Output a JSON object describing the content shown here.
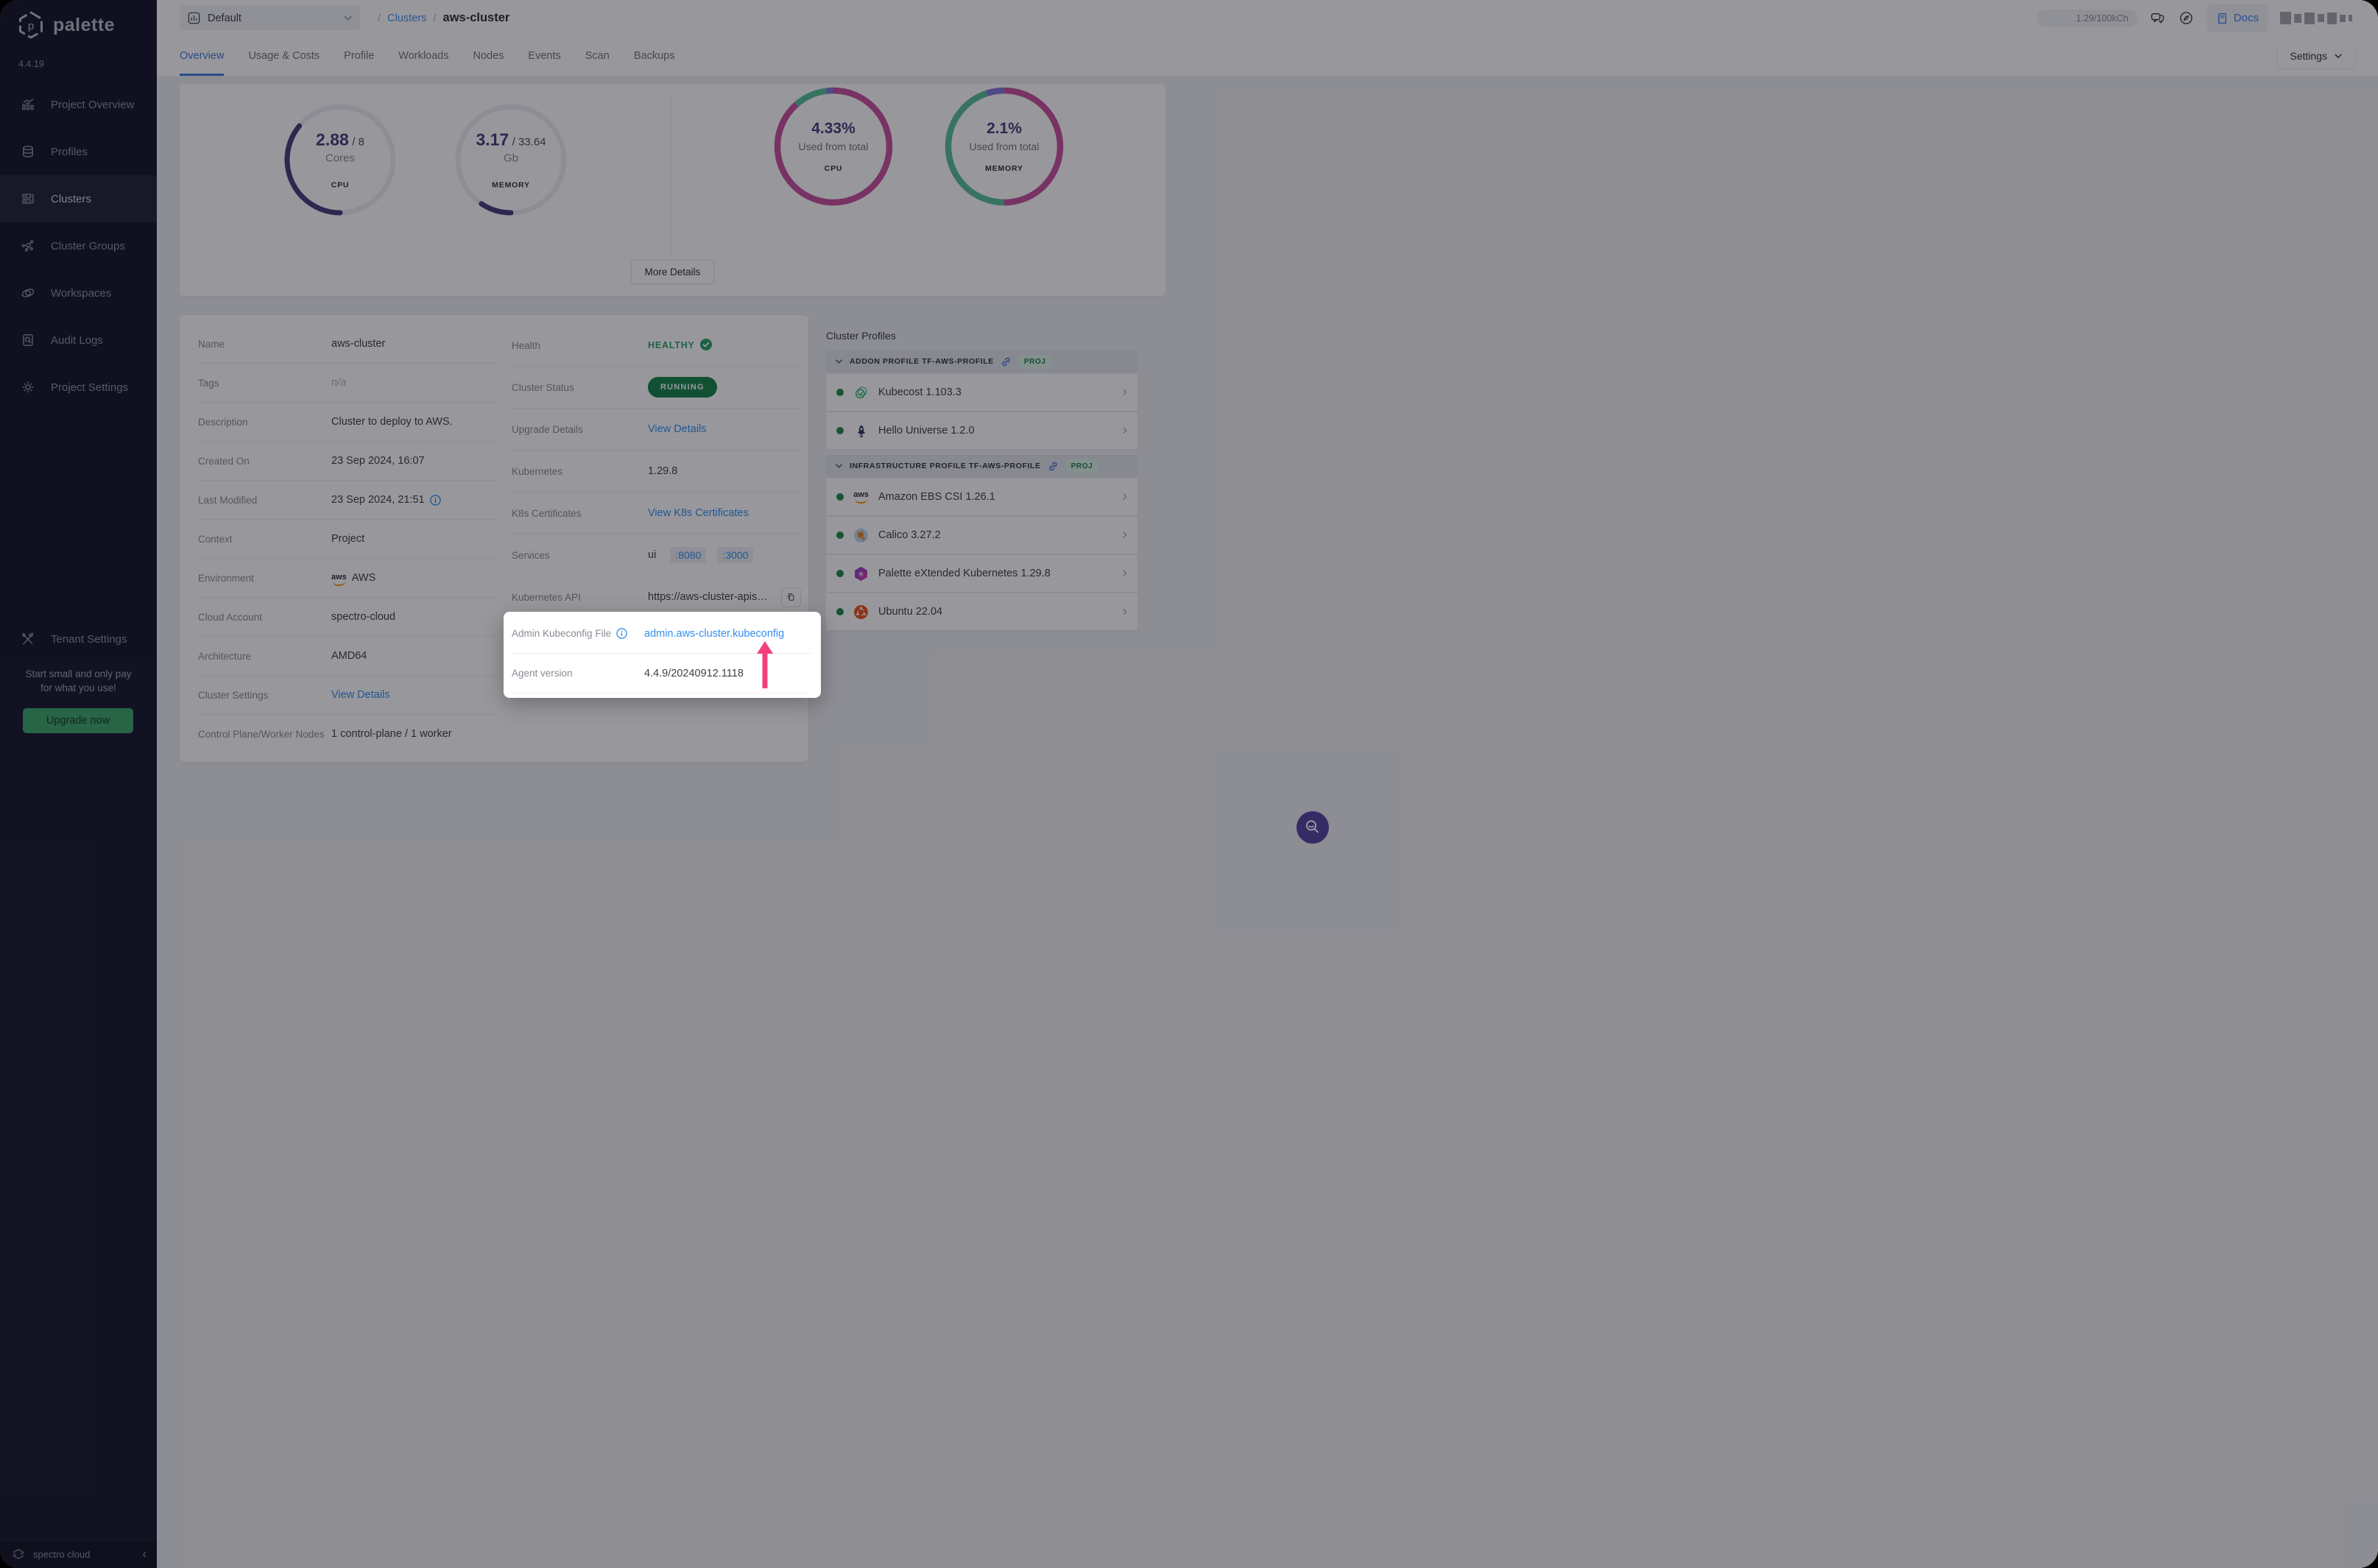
{
  "topbar": {
    "project_selector": "Default",
    "breadcrumb_sep": "/",
    "breadcrumb_section": "Clusters",
    "breadcrumb_current": "aws-cluster",
    "credits": "1.29/100kCh",
    "docs_label": "Docs"
  },
  "tabs": {
    "items": [
      "Overview",
      "Usage & Costs",
      "Profile",
      "Workloads",
      "Nodes",
      "Events",
      "Scan",
      "Backups"
    ],
    "active_index": 0,
    "settings_label": "Settings"
  },
  "sidebar": {
    "brand": "palette",
    "version": "4.4.19",
    "items": [
      {
        "label": "Project Overview",
        "icon": "chart",
        "active": false
      },
      {
        "label": "Profiles",
        "icon": "layers",
        "active": false
      },
      {
        "label": "Clusters",
        "icon": "clusters",
        "active": true
      },
      {
        "label": "Cluster Groups",
        "icon": "groups",
        "active": false
      },
      {
        "label": "Workspaces",
        "icon": "orbit",
        "active": false
      },
      {
        "label": "Audit Logs",
        "icon": "audit",
        "active": false
      },
      {
        "label": "Project Settings",
        "icon": "gear",
        "active": false
      }
    ],
    "tenant_settings": "Tenant Settings",
    "promo_line1": "Start small and only pay",
    "promo_line2": "for what you use!",
    "upgrade_label": "Upgrade now",
    "footer_brand": "spectro cloud"
  },
  "usage_card": {
    "cpu_gauge": {
      "used": "2.88",
      "total_display": "/ 8",
      "unit": "Cores",
      "label": "CPU",
      "fraction": 0.36
    },
    "memory_gauge": {
      "used": "3.17",
      "total_display": "/ 33.64",
      "unit": "Gb",
      "label": "MEMORY",
      "fraction": 0.094
    },
    "cpu_ring": {
      "percent": "4.33%",
      "caption": "Used from total",
      "label": "CPU",
      "segments": [
        {
          "name": "used-other",
          "color": "#C9519F",
          "fraction": 0.885
        },
        {
          "name": "free",
          "color": "#5BBF9B",
          "fraction": 0.095
        },
        {
          "name": "this-cluster",
          "color": "#8678D9",
          "fraction": 0.02
        }
      ]
    },
    "memory_ring": {
      "percent": "2.1%",
      "caption": "Used from total",
      "label": "MEMORY",
      "segments": [
        {
          "name": "used-other",
          "color": "#C9519F",
          "fraction": 0.5
        },
        {
          "name": "free",
          "color": "#5BBF9B",
          "fraction": 0.45
        },
        {
          "name": "this-cluster",
          "color": "#8678D9",
          "fraction": 0.05
        }
      ]
    },
    "more_details_label": "More Details"
  },
  "details_left": [
    {
      "label": "Name",
      "type": "text",
      "value": "aws-cluster"
    },
    {
      "label": "Tags",
      "type": "muted",
      "value": "n/a"
    },
    {
      "label": "Description",
      "type": "text",
      "value": "Cluster to deploy to AWS."
    },
    {
      "label": "Created On",
      "type": "text",
      "value": "23 Sep 2024, 16:07"
    },
    {
      "label": "Last Modified",
      "type": "text",
      "value": "23 Sep 2024, 21:51",
      "info": true
    },
    {
      "label": "Context",
      "type": "text",
      "value": "Project"
    },
    {
      "label": "Environment",
      "type": "env",
      "value": "AWS"
    },
    {
      "label": "Cloud Account",
      "type": "text",
      "value": "spectro-cloud"
    },
    {
      "label": "Architecture",
      "type": "text",
      "value": "AMD64"
    },
    {
      "label": "Cluster Settings",
      "type": "link",
      "value": "View Details"
    },
    {
      "label": "Control Plane/Worker Nodes",
      "type": "text",
      "value": "1 control-plane / 1 worker"
    }
  ],
  "details_mid": [
    {
      "label": "Health",
      "type": "health",
      "value": "HEALTHY"
    },
    {
      "label": "Cluster Status",
      "type": "pill",
      "value": "RUNNING"
    },
    {
      "label": "Upgrade Details",
      "type": "link",
      "value": "View Details"
    },
    {
      "label": "Kubernetes",
      "type": "text",
      "value": "1.29.8"
    },
    {
      "label": "K8s Certificates",
      "type": "link",
      "value": "View K8s Certificates"
    },
    {
      "label": "Services",
      "type": "services",
      "value": "ui",
      "chips": [
        ":8080",
        ":3000"
      ]
    },
    {
      "label": "Kubernetes API",
      "type": "api",
      "value": "https://aws-cluster-apiserve..."
    }
  ],
  "spotlight": {
    "row1_label": "Admin Kubeconfig File",
    "row1_link": "admin.aws-cluster.kubeconfig",
    "row2_label": "Agent version",
    "row2_value": "4.4.9/20240912.1118"
  },
  "cluster_profiles": {
    "title": "Cluster Profiles",
    "groups": [
      {
        "name": "ADDON PROFILE TF-AWS-PROFILE",
        "badge": "PROJ",
        "packs": [
          {
            "name": "Kubecost 1.103.3",
            "icon": "kubecost"
          },
          {
            "name": "Hello Universe 1.2.0",
            "icon": "rocket"
          }
        ]
      },
      {
        "name": "INFRASTRUCTURE PROFILE TF-AWS-PROFILE",
        "badge": "PROJ",
        "packs": [
          {
            "name": "Amazon EBS CSI 1.26.1",
            "icon": "aws"
          },
          {
            "name": "Calico 3.27.2",
            "icon": "calico"
          },
          {
            "name": "Palette eXtended Kubernetes 1.29.8",
            "icon": "pxk"
          },
          {
            "name": "Ubuntu 22.04",
            "icon": "ubuntu"
          }
        ]
      }
    ]
  },
  "colors": {
    "accent_blue": "#338EF0",
    "status_green": "#17834A",
    "gauge_indigo": "#453E7D",
    "ring_magenta": "#C9519F",
    "ring_green": "#5BBF9B",
    "ring_purple": "#8678D9",
    "arrow_pink": "#F3407D"
  }
}
